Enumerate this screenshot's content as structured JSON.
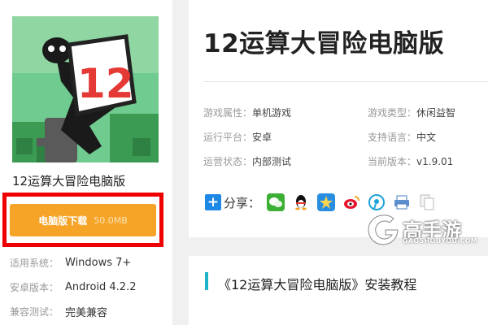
{
  "app": {
    "name": "12运算大冒险电脑版",
    "title": "12运算大冒险电脑版",
    "icon": "12-box-character-icon",
    "icon_number": "12"
  },
  "download": {
    "label": "电脑版下载",
    "size": "50.0MB",
    "color": "#f6a427",
    "highlight_color": "#e00000"
  },
  "specs": [
    {
      "label": "适用系统：",
      "value": "Windows 7+"
    },
    {
      "label": "安卓版本：",
      "value": "Android 4.2.2"
    },
    {
      "label": "兼容测试：",
      "value": "完美兼容"
    }
  ],
  "attributes": {
    "game_attr": {
      "label": "游戏属性：",
      "value": "单机游戏"
    },
    "game_type": {
      "label": "游戏类型：",
      "value": "休闲益智"
    },
    "platform": {
      "label": "运行平台：",
      "value": "安卓"
    },
    "language": {
      "label": "支持语言：",
      "value": "中文"
    },
    "status": {
      "label": "运营状态：",
      "value": "内部测试"
    },
    "version": {
      "label": "当前版本：",
      "value": "v1.9.01"
    }
  },
  "share": {
    "label": "分享：",
    "icons": [
      "wechat-icon",
      "qq-icon",
      "qzone-icon",
      "weibo-icon",
      "tencent-weibo-icon",
      "print-icon",
      "copy-icon"
    ]
  },
  "tutorial": {
    "title": "《12运算大冒险电脑版》安装教程",
    "accent": "#1cb5c7"
  },
  "watermark": {
    "brand": "高手游",
    "domain": "GAOSHOUYOU.COM"
  }
}
